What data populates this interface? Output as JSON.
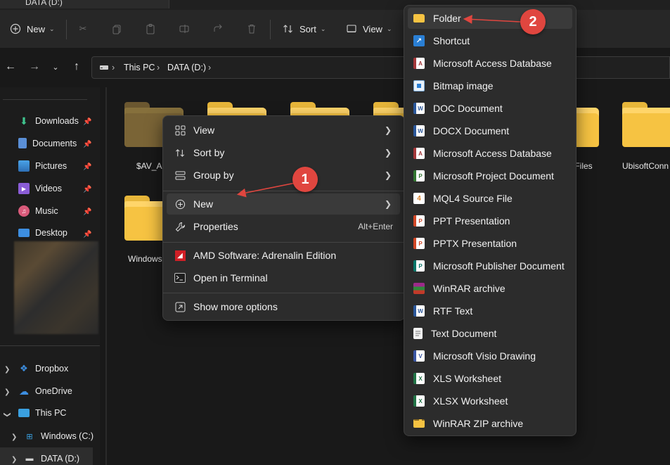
{
  "window": {
    "tab_title": "DATA (D:)"
  },
  "toolbar": {
    "new_label": "New",
    "sort_label": "Sort",
    "view_label": "View"
  },
  "address": {
    "crumbs": [
      "This PC",
      "DATA (D:)"
    ]
  },
  "sidebar": {
    "quick": [
      {
        "label": "Downloads"
      },
      {
        "label": "Documents"
      },
      {
        "label": "Pictures"
      },
      {
        "label": "Videos"
      },
      {
        "label": "Music"
      },
      {
        "label": "Desktop"
      }
    ],
    "tree": [
      {
        "label": "Dropbox"
      },
      {
        "label": "OneDrive"
      },
      {
        "label": "This PC"
      },
      {
        "label": "Windows (C:)"
      },
      {
        "label": "DATA (D:)"
      }
    ]
  },
  "content": {
    "folders": [
      {
        "label": "$AV_AS"
      },
      {
        "label": "Files"
      },
      {
        "label": "UbisoftConn"
      },
      {
        "label": "Windows"
      }
    ]
  },
  "context_menu": {
    "items": [
      {
        "label": "View",
        "icon": "grid-icon"
      },
      {
        "label": "Sort by",
        "icon": "sort-icon"
      },
      {
        "label": "Group by",
        "icon": "group-icon"
      },
      {
        "label": "New",
        "icon": "plus-circle-icon"
      },
      {
        "label": "Properties",
        "icon": "wrench-icon",
        "shortcut": "Alt+Enter"
      },
      {
        "label": "AMD Software: Adrenalin Edition",
        "icon": "amd-icon"
      },
      {
        "label": "Open in Terminal",
        "icon": "terminal-icon"
      },
      {
        "label": "Show more options",
        "icon": "share-icon"
      }
    ]
  },
  "new_submenu": {
    "items": [
      {
        "label": "Folder"
      },
      {
        "label": "Shortcut"
      },
      {
        "label": "Microsoft Access Database"
      },
      {
        "label": "Bitmap image"
      },
      {
        "label": "DOC Document"
      },
      {
        "label": "DOCX Document"
      },
      {
        "label": "Microsoft Access Database"
      },
      {
        "label": "Microsoft Project Document"
      },
      {
        "label": "MQL4 Source File"
      },
      {
        "label": "PPT Presentation"
      },
      {
        "label": "PPTX Presentation"
      },
      {
        "label": "Microsoft Publisher Document"
      },
      {
        "label": "WinRAR archive"
      },
      {
        "label": "RTF Text"
      },
      {
        "label": "Text Document"
      },
      {
        "label": "Microsoft Visio Drawing"
      },
      {
        "label": "XLS Worksheet"
      },
      {
        "label": "XLSX Worksheet"
      },
      {
        "label": "WinRAR ZIP archive"
      }
    ]
  },
  "annotations": {
    "step1": "1",
    "step2": "2"
  },
  "colors": {
    "annotation_red": "#e0463f",
    "folder_yellow": "#f6c342",
    "background": "#191919"
  }
}
